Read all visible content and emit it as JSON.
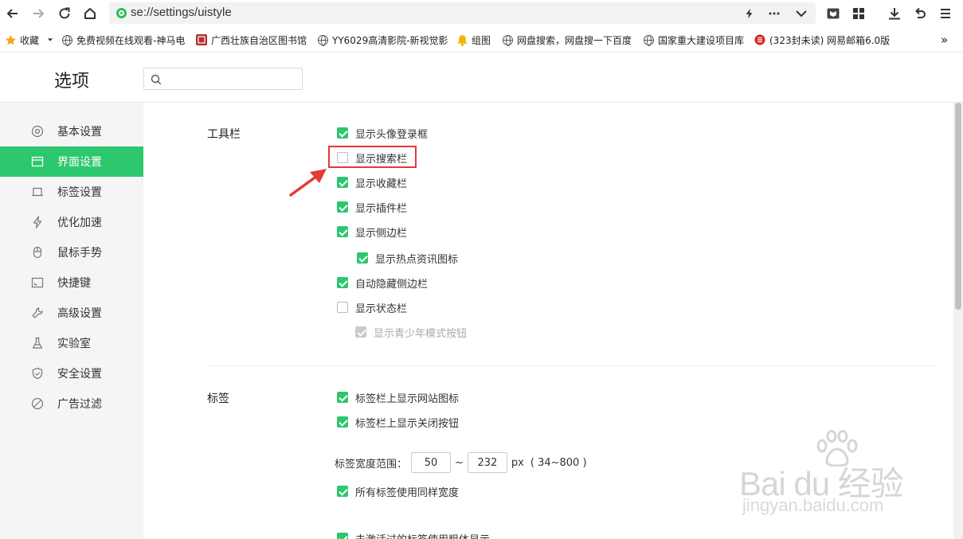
{
  "browser": {
    "url": "se://settings/uistyle",
    "nav_icons": [
      "back-arrow-icon",
      "forward-arrow-icon",
      "refresh-icon",
      "home-icon"
    ],
    "right_icons": [
      "lightning-icon",
      "more-icon",
      "dropdown-icon",
      "reader-icon",
      "apps-icon",
      "download-icon",
      "undo-icon",
      "menu-icon"
    ]
  },
  "bookmarks": {
    "favorites_label": "收藏",
    "items": [
      "免费视频在线观看-神马电",
      "广西壮族自治区图书馆",
      "YY6029高清影院-新视觉影",
      "组图",
      "网盘搜索，网盘搜一下百度",
      "国家重大建设项目库",
      "(323封未读) 网易邮箱6.0版"
    ],
    "overflow": "»"
  },
  "header": {
    "title": "选项",
    "search_value": ""
  },
  "sidebar": {
    "items": [
      {
        "label": "基本设置",
        "icon": "gear-circle-icon"
      },
      {
        "label": "界面设置",
        "icon": "window-icon"
      },
      {
        "label": "标签设置",
        "icon": "tab-icon"
      },
      {
        "label": "优化加速",
        "icon": "lightning-icon"
      },
      {
        "label": "鼠标手势",
        "icon": "mouse-icon"
      },
      {
        "label": "快捷键",
        "icon": "keyboard-icon"
      },
      {
        "label": "高级设置",
        "icon": "wrench-icon"
      },
      {
        "label": "实验室",
        "icon": "flask-icon"
      },
      {
        "label": "安全设置",
        "icon": "shield-icon"
      },
      {
        "label": "广告过滤",
        "icon": "block-icon"
      }
    ],
    "active_index": 1
  },
  "toolbar_section": {
    "title": "工具栏",
    "options": [
      {
        "label": "显示头像登录框",
        "checked": true
      },
      {
        "label": "显示搜索栏",
        "checked": false
      },
      {
        "label": "显示收藏栏",
        "checked": true
      },
      {
        "label": "显示插件栏",
        "checked": true
      },
      {
        "label": "显示侧边栏",
        "checked": true
      },
      {
        "label": "显示热点资讯图标",
        "checked": true
      },
      {
        "label": "自动隐藏侧边栏",
        "checked": true
      },
      {
        "label": "显示状态栏",
        "checked": false
      },
      {
        "label": "显示青少年模式按钮",
        "checked": true,
        "disabled": true
      }
    ]
  },
  "tabs_section": {
    "title": "标签",
    "options": [
      {
        "label": "标签栏上显示网站图标",
        "checked": true
      },
      {
        "label": "标签栏上显示关闭按钮",
        "checked": true
      },
      {
        "label": "所有标签使用同样宽度",
        "checked": true
      },
      {
        "label": "未激活过的标签使用粗体显示",
        "checked": true
      }
    ],
    "width_range": {
      "label": "标签宽度范围：",
      "min": "50",
      "separator": "~",
      "max": "232",
      "unit": "px",
      "hint": "( 34~800 )"
    }
  },
  "watermark": {
    "main": "Bai du 经验",
    "sub": "jingyan.baidu.com"
  },
  "colors": {
    "accent": "#2dc76d",
    "highlight": "#e53935"
  }
}
